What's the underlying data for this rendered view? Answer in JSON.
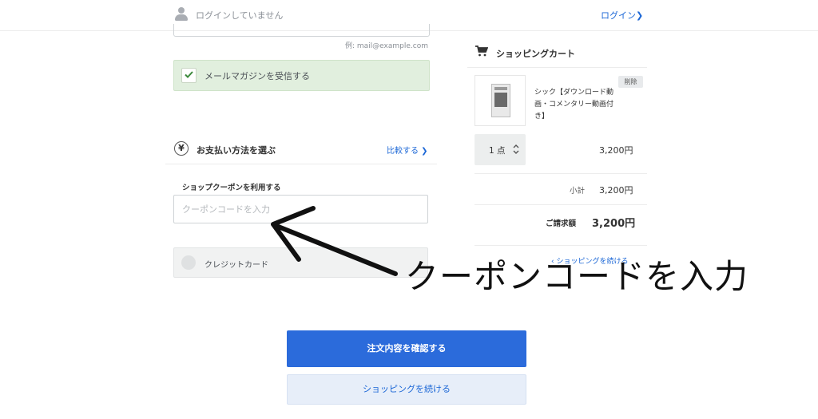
{
  "header": {
    "not_logged_in": "ログインしていません",
    "login_link": "ログイン❯"
  },
  "email": {
    "example": "例: mail@example.com"
  },
  "newsletter": {
    "label": "メールマガジンを受信する",
    "checked": true
  },
  "payment": {
    "title": "お支払い方法を選ぶ",
    "compare_link": "比較する ❯",
    "coupon_label": "ショップクーポンを利用する",
    "coupon_placeholder": "クーポンコードを入力",
    "credit_label": "クレジットカード"
  },
  "cart": {
    "title": "ショッピングカート",
    "item": {
      "name": "シック【ダウンロード動画・コメンタリー動画付き】",
      "delete_label": "削除",
      "quantity": "1 点",
      "price": "3,200円"
    },
    "subtotal_label": "小計",
    "subtotal_value": "3,200円",
    "total_label": "ご請求額",
    "total_value": "3,200円",
    "continue_link": "‹ ショッピングを続ける"
  },
  "buttons": {
    "confirm": "注文内容を確認する",
    "continue": "ショッピングを続ける"
  },
  "annotation": {
    "text": "クーポンコードを入力"
  },
  "colors": {
    "accent": "#2b6bdb",
    "link": "#1a66d6",
    "newsletter_bg": "#e1efde"
  }
}
